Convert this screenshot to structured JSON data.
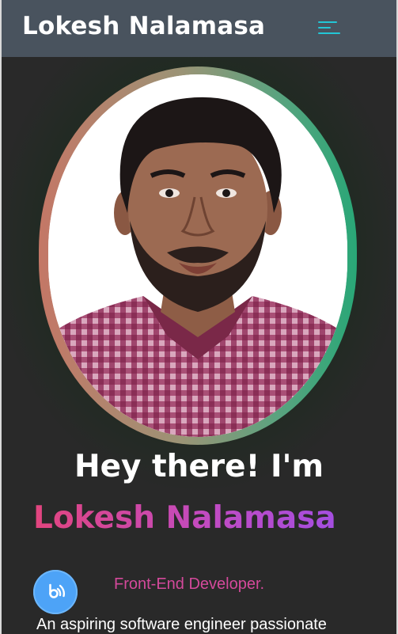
{
  "header": {
    "brand": "Lokesh Nalamasa",
    "menu_icon": "hamburger-menu-icon"
  },
  "hero": {
    "avatar_alt": "Portrait of Lokesh Nalamasa",
    "greeting": "Hey there! I'm",
    "name": "Lokesh Nalamasa",
    "role": "Front-End Developer.",
    "bio": "An aspiring software engineer passionate",
    "action_icon": "contact-fab-icon"
  },
  "colors": {
    "header_bg": "#49535e",
    "menu_accent": "#23c6d6",
    "page_bg": "#2a2a2a",
    "name_gradient_start": "#e2457e",
    "name_gradient_end": "#a44ee0",
    "role_color": "#d4499b",
    "fab_bg": "#4da3f7"
  }
}
